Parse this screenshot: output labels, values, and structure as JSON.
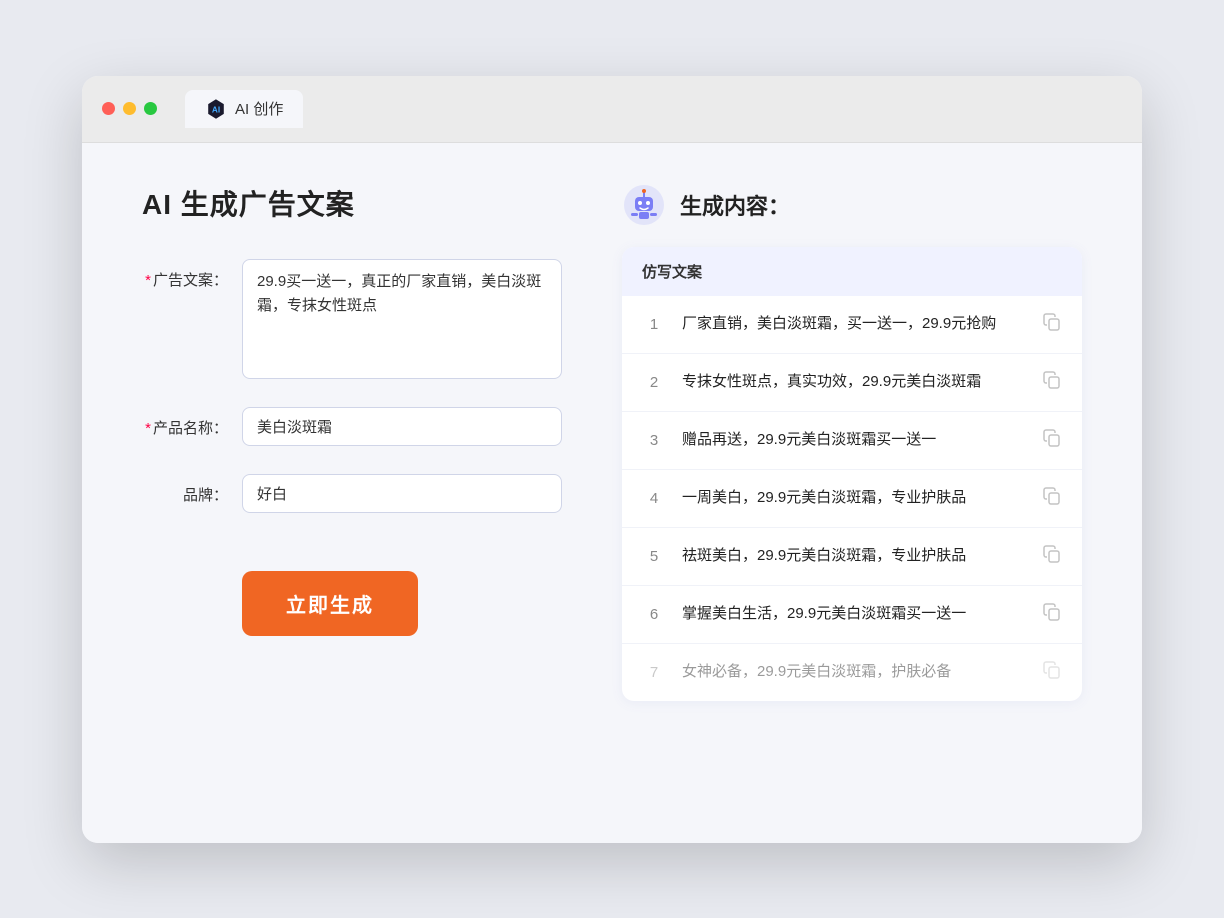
{
  "browser": {
    "tab_label": "AI 创作"
  },
  "page": {
    "title": "AI 生成广告文案",
    "result_title": "生成内容："
  },
  "form": {
    "ad_copy_label": "广告文案：",
    "ad_copy_required": "*",
    "ad_copy_value": "29.9买一送一，真正的厂家直销，美白淡斑霜，专抹女性斑点",
    "product_name_label": "产品名称：",
    "product_name_required": "*",
    "product_name_value": "美白淡斑霜",
    "brand_label": "品牌：",
    "brand_value": "好白",
    "submit_label": "立即生成"
  },
  "results": {
    "table_header": "仿写文案",
    "items": [
      {
        "num": "1",
        "text": "厂家直销，美白淡斑霜，买一送一，29.9元抢购",
        "faded": false
      },
      {
        "num": "2",
        "text": "专抹女性斑点，真实功效，29.9元美白淡斑霜",
        "faded": false
      },
      {
        "num": "3",
        "text": "赠品再送，29.9元美白淡斑霜买一送一",
        "faded": false
      },
      {
        "num": "4",
        "text": "一周美白，29.9元美白淡斑霜，专业护肤品",
        "faded": false
      },
      {
        "num": "5",
        "text": "祛斑美白，29.9元美白淡斑霜，专业护肤品",
        "faded": false
      },
      {
        "num": "6",
        "text": "掌握美白生活，29.9元美白淡斑霜买一送一",
        "faded": false
      },
      {
        "num": "7",
        "text": "女神必备，29.9元美白淡斑霜，护肤必备",
        "faded": true
      }
    ]
  }
}
